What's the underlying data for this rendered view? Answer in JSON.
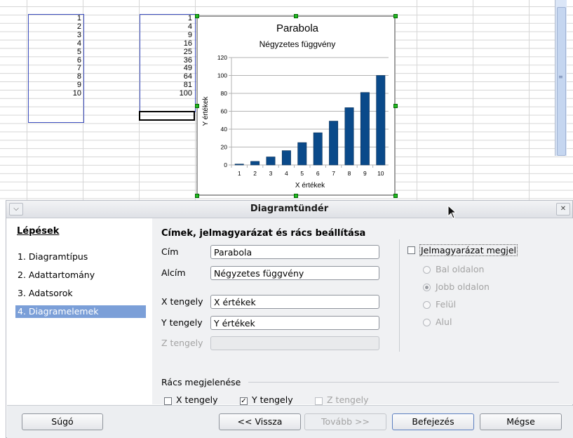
{
  "sheet": {
    "col_a": [
      "1",
      "2",
      "3",
      "4",
      "5",
      "6",
      "7",
      "8",
      "9",
      "10"
    ],
    "col_b": [
      "1",
      "4",
      "9",
      "16",
      "25",
      "36",
      "49",
      "64",
      "81",
      "100"
    ]
  },
  "chart_data": {
    "type": "bar",
    "title": "Parabola",
    "subtitle": "Négyzetes függvény",
    "xlabel": "X értékek",
    "ylabel": "Y értékek",
    "categories": [
      "1",
      "2",
      "3",
      "4",
      "5",
      "6",
      "7",
      "8",
      "9",
      "10"
    ],
    "values": [
      1,
      4,
      9,
      16,
      25,
      36,
      49,
      64,
      81,
      100
    ],
    "ylim": [
      0,
      120
    ],
    "yticks": [
      "0",
      "20",
      "40",
      "60",
      "80",
      "100",
      "120"
    ],
    "grid": true,
    "legend": "none",
    "bar_color": "#0a4a8a"
  },
  "dialog": {
    "title": "Diagramtündér",
    "menu_icon": "chevron-down-icon",
    "close_icon": "close-icon",
    "steps_title": "Lépések",
    "steps": [
      "1. Diagramtípus",
      "2. Adattartomány",
      "3. Adatsorok",
      "4. Diagramelemek"
    ],
    "section_title": "Címek, jelmagyarázat és rács beállítása",
    "fields": {
      "title_label": "Cím",
      "title_value": "Parabola",
      "subtitle_label": "Alcím",
      "subtitle_value": "Négyzetes függvény",
      "xaxis_label": "X tengely",
      "xaxis_value": "X értékek",
      "yaxis_label": "Y tengely",
      "yaxis_value": "Y értékek",
      "zaxis_label": "Z tengely",
      "zaxis_value": ""
    },
    "legend": {
      "checkbox_label": "Jelmagyarázat megjel",
      "options": [
        "Bal oldalon",
        "Jobb oldalon",
        "Felül",
        "Alul"
      ],
      "selected": "Jobb oldalon"
    },
    "grid": {
      "title": "Rács megjelenése",
      "x_label": "X tengely",
      "x_checked": false,
      "y_label": "Y tengely",
      "y_checked": true,
      "z_label": "Z tengely",
      "z_checked": false
    },
    "buttons": {
      "help": "Súgó",
      "back": "<< Vissza",
      "next": "Tovább >>",
      "finish": "Befejezés",
      "cancel": "Mégse"
    },
    "accent_color": "#7b9fd8"
  }
}
